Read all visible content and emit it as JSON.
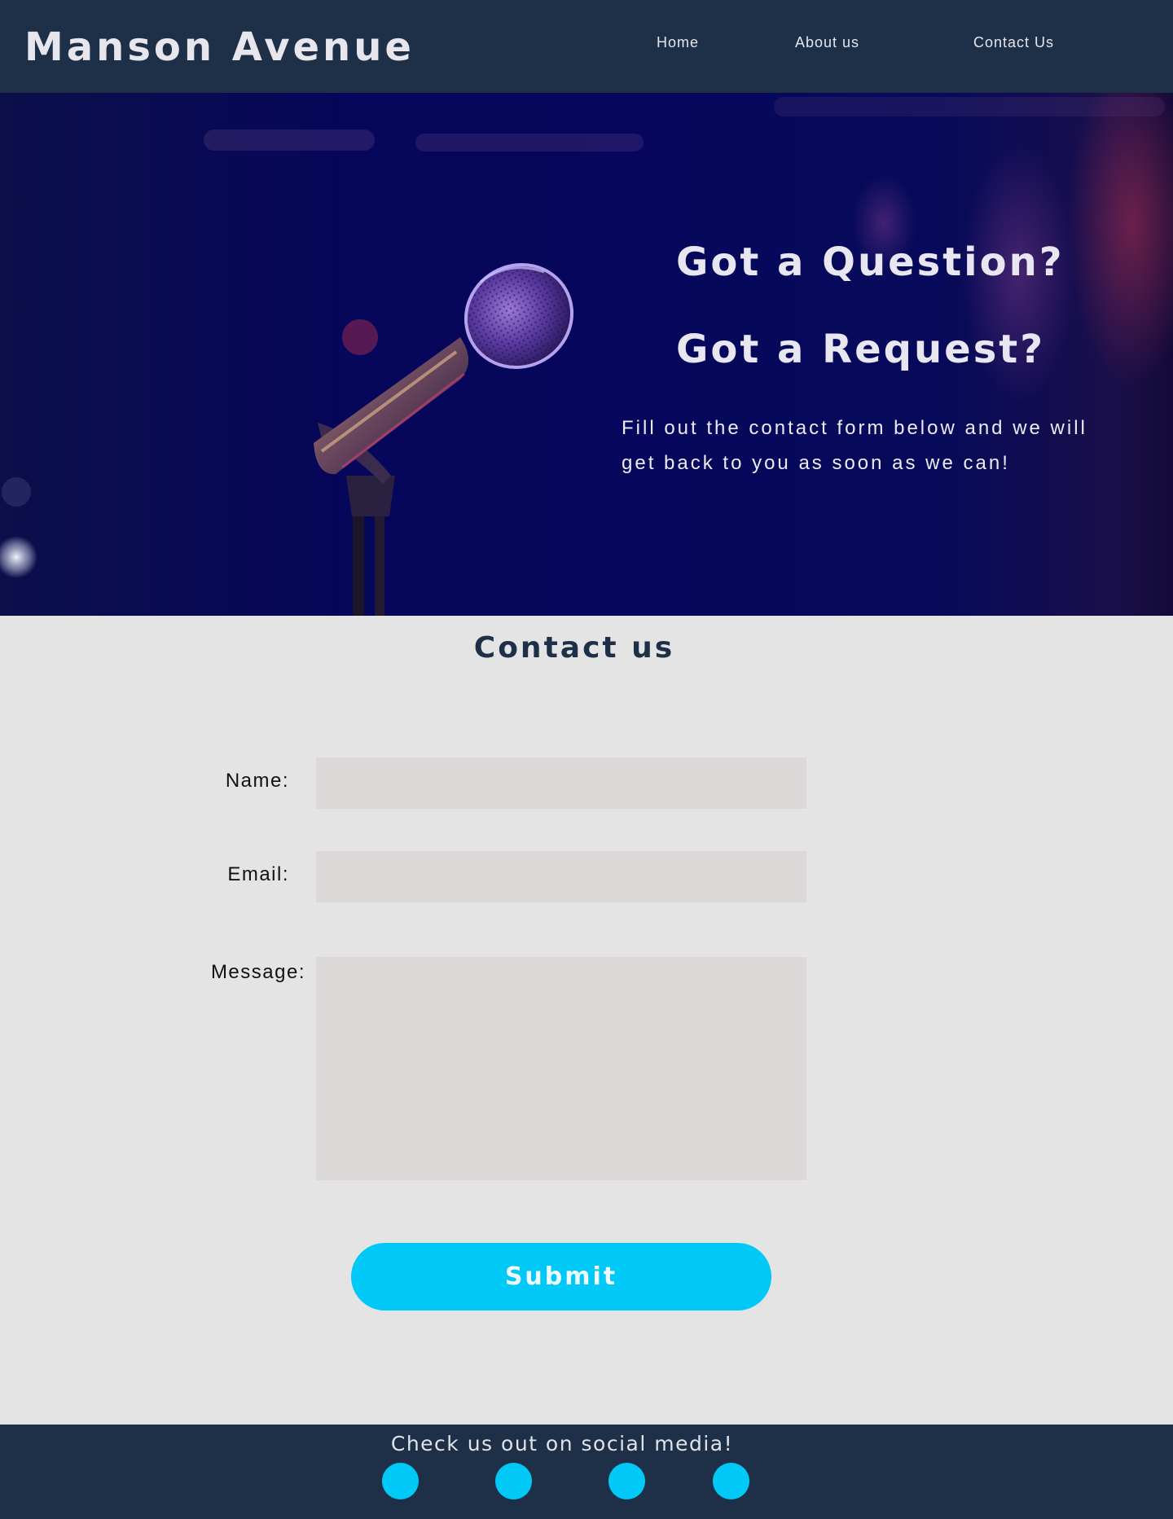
{
  "header": {
    "brand": "Manson Avenue",
    "nav": {
      "home": "Home",
      "about": "About us",
      "contact": "Contact Us"
    }
  },
  "hero": {
    "question": "Got a Question?",
    "request": "Got a Request?",
    "text": "Fill out the contact form below and we will get back to you as soon as we can!",
    "image": "microphone-stage-photo"
  },
  "contact": {
    "title": "Contact us",
    "name_label": "Name:",
    "name_value": "",
    "email_label": "Email:",
    "email_value": "",
    "message_label": "Message:",
    "message_value": "",
    "submit_label": "Submit"
  },
  "footer": {
    "text": "Check us out on social media!",
    "social_icons": [
      "social-icon",
      "social-icon",
      "social-icon",
      "social-icon"
    ]
  },
  "colors": {
    "header_bg": "#1e2f48",
    "page_bg": "#e5e4e4",
    "accent": "#00c9f7",
    "field_bg": "#dbd8d7"
  }
}
